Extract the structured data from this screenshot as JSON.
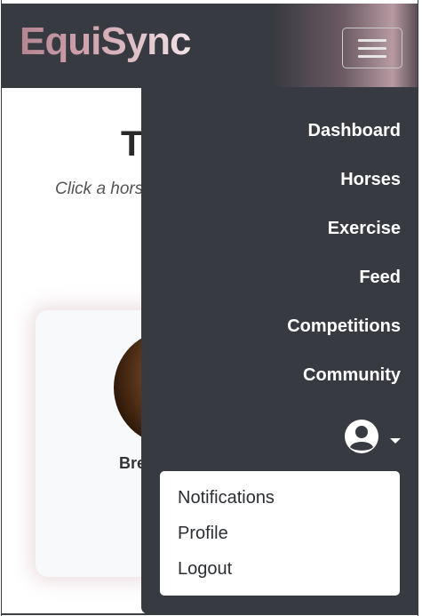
{
  "brand": {
    "name": "EquiSync"
  },
  "page": {
    "title": "T",
    "subtitle": "Click a hors"
  },
  "card": {
    "name": "Bre"
  },
  "nav": {
    "items": [
      {
        "label": "Dashboard"
      },
      {
        "label": "Horses"
      },
      {
        "label": "Exercise"
      },
      {
        "label": "Feed"
      },
      {
        "label": "Competitions"
      },
      {
        "label": "Community"
      }
    ]
  },
  "user_menu": {
    "icon": "user-circle-icon",
    "items": [
      {
        "label": "Notifications"
      },
      {
        "label": "Profile"
      },
      {
        "label": "Logout"
      }
    ]
  },
  "colors": {
    "navbar": "#373a40",
    "brand_gradient_start": "#b48591",
    "brand_gradient_end": "#f1e3e7",
    "menu_text": "#ffffff",
    "dropdown_bg": "#ffffff"
  }
}
